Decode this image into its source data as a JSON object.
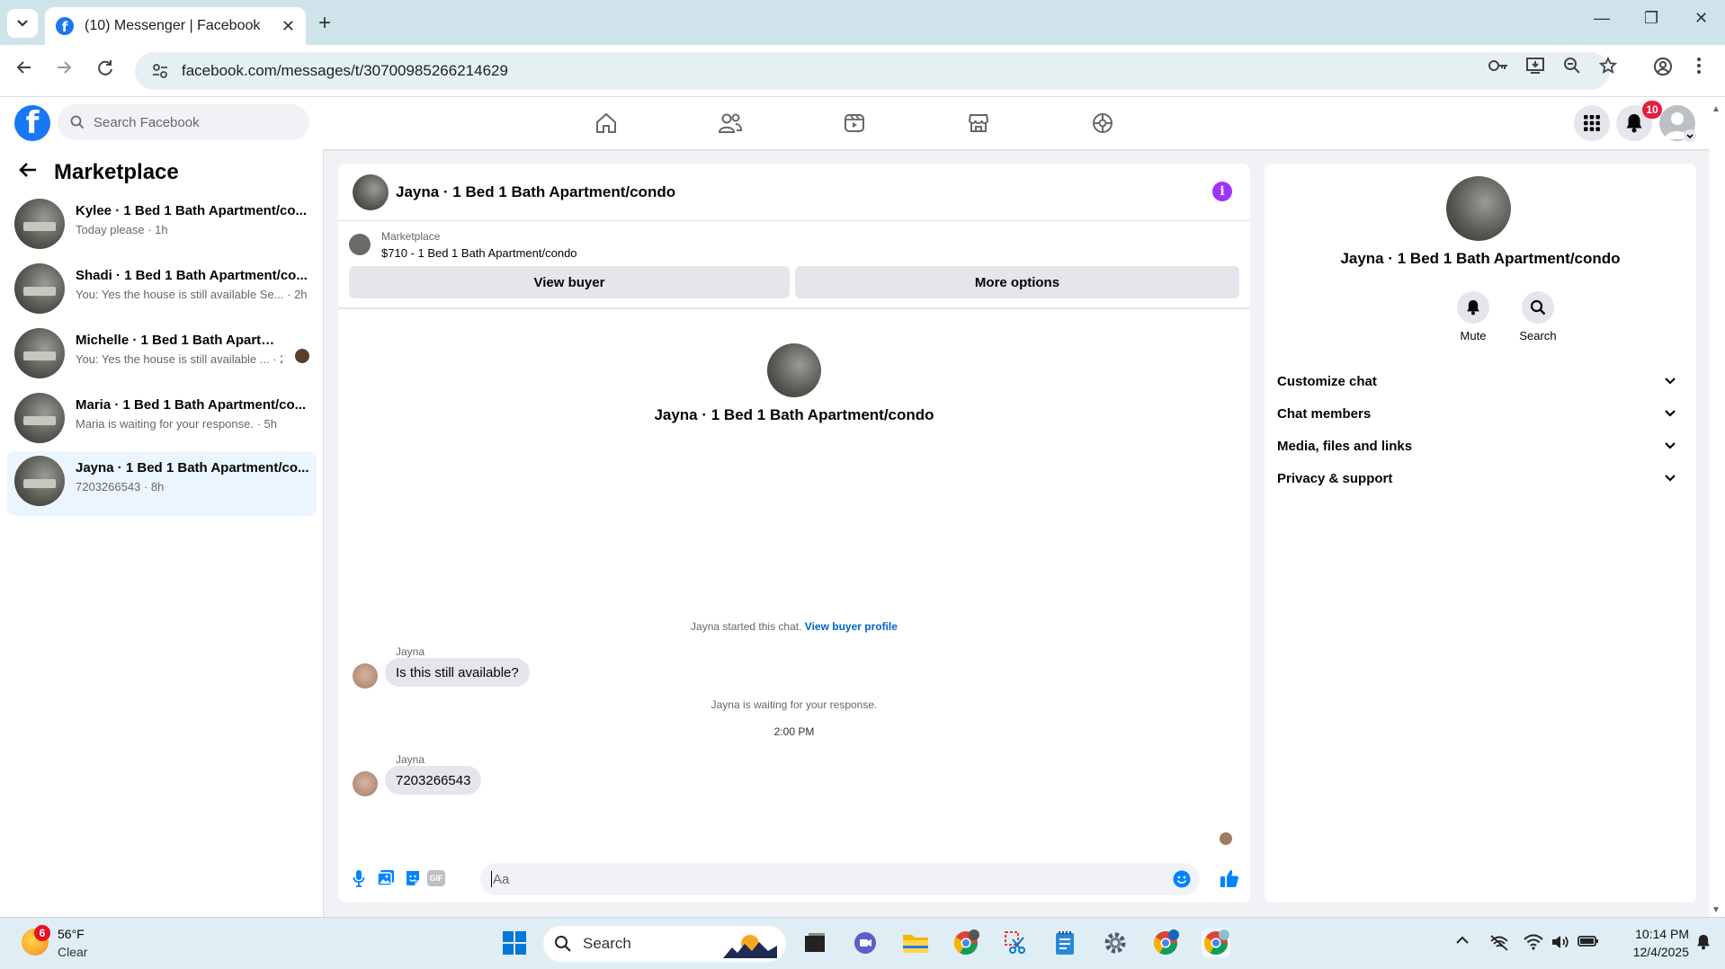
{
  "browser": {
    "tab_title": "(10) Messenger | Facebook",
    "url": "facebook.com/messages/t/30700985266214629"
  },
  "fb": {
    "search_placeholder": "Search Facebook",
    "notification_count": "10"
  },
  "sidebar": {
    "title": "Marketplace",
    "conversations": [
      {
        "name": "Kylee · 1 Bed 1 Bath Apartment/co...",
        "preview": "Today please · 1h"
      },
      {
        "name": "Shadi · 1 Bed 1 Bath Apartment/co...",
        "preview": "You: Yes the house is still available Se... · 2h"
      },
      {
        "name": "Michelle · 1 Bed 1 Bath Apartme...",
        "preview": "You: Yes the house is still available ... · 2h"
      },
      {
        "name": "Maria · 1 Bed 1 Bath Apartment/co...",
        "preview": "Maria is waiting for your response. · 5h"
      },
      {
        "name": "Jayna · 1 Bed 1 Bath Apartment/co...",
        "preview": "7203266543 · 8h"
      }
    ]
  },
  "chat": {
    "title": "Jayna · 1 Bed 1 Bath Apartment/condo",
    "marketplace_label": "Marketplace",
    "listing": "$710 - 1 Bed 1 Bath Apartment/condo",
    "view_buyer": "View buyer",
    "more_options": "More options",
    "profile_name": "Jayna · 1 Bed 1 Bath Apartment/condo",
    "started_text": "Jayna started this chat.",
    "view_buyer_profile": "View buyer profile",
    "msg1_sender": "Jayna",
    "msg1_text": "Is this still available?",
    "waiting_text": "Jayna is waiting for your response.",
    "timestamp": "2:00 PM",
    "msg2_sender": "Jayna",
    "msg2_text": "7203266543",
    "input_placeholder": "Aa",
    "gif_label": "GIF"
  },
  "info": {
    "name": "Jayna · 1 Bed 1 Bath Apartment/condo",
    "mute": "Mute",
    "search": "Search",
    "sections": [
      "Customize chat",
      "Chat members",
      "Media, files and links",
      "Privacy & support"
    ]
  },
  "taskbar": {
    "weather_badge": "6",
    "temp": "56°F",
    "condition": "Clear",
    "search": "Search",
    "time": "10:14 PM",
    "date": "12/4/2025"
  },
  "colors": {
    "brand": "#1877f2",
    "messenger_accent": "#0084ff",
    "info_purple": "#a033ff"
  }
}
